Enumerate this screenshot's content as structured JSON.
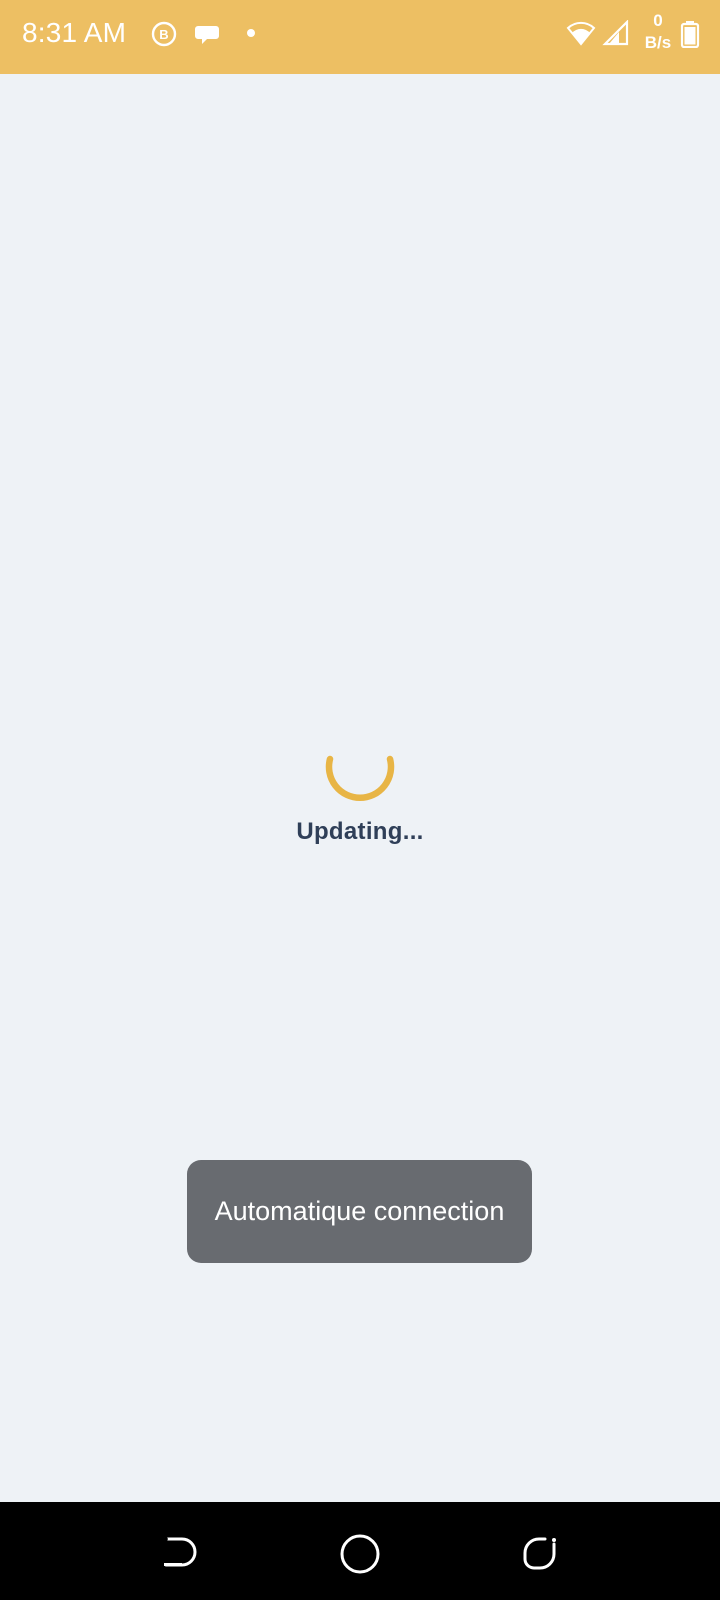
{
  "status_bar": {
    "time": "8:31 AM",
    "net_speed_value": "0",
    "net_speed_unit": "B/s",
    "left_icons": [
      "b-badge-icon",
      "chat-bubble-icon",
      "notification-dot-icon"
    ],
    "right_icons": [
      "wifi-icon",
      "cellular-signal-icon",
      "battery-icon"
    ],
    "color": "#edbf63"
  },
  "main": {
    "loading_text": "Updating...",
    "spinner_color": "#e8b545",
    "background": "#eef2f6"
  },
  "toast": {
    "message": "Automatique connection"
  },
  "nav_bar": {
    "buttons": [
      "back-icon",
      "home-icon",
      "recent-apps-icon"
    ]
  }
}
